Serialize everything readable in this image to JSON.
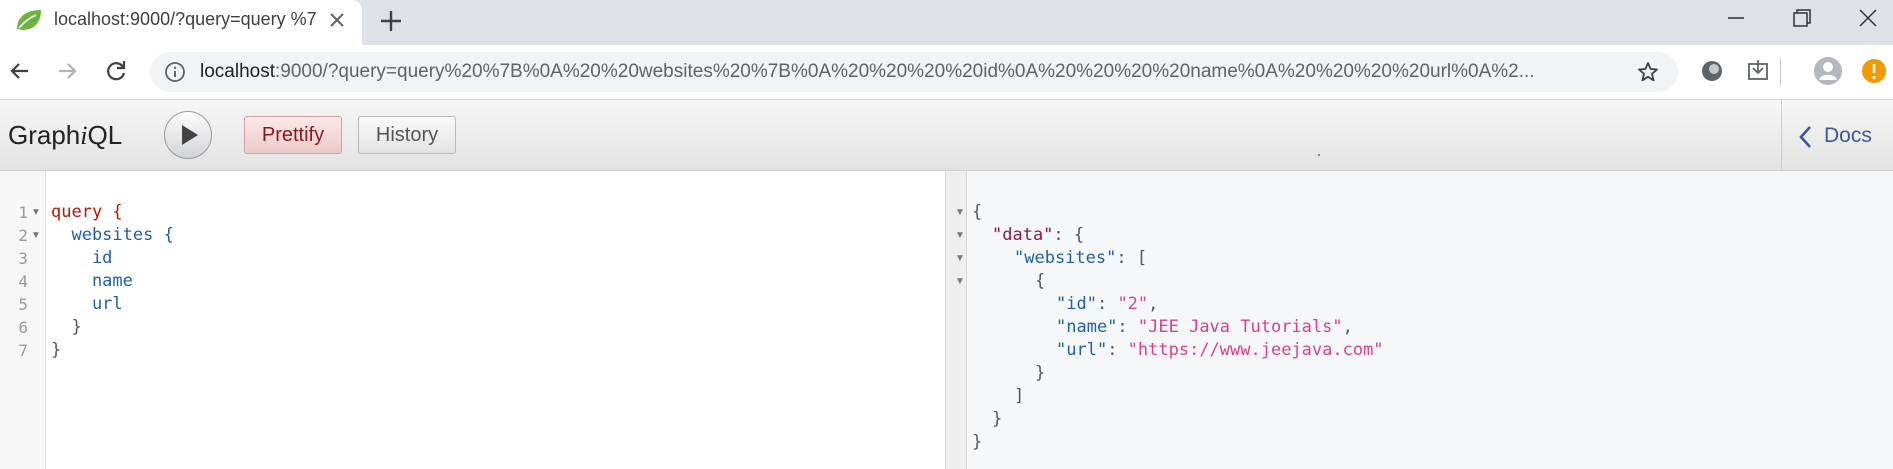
{
  "browser": {
    "tab_title": "localhost:9000/?query=query %7",
    "url_host": "localhost",
    "url_rest": ":9000/?query=query%20%7B%0A%20%20websites%20%7B%0A%20%20%20%20id%0A%20%20%20%20name%0A%20%20%20%20url%0A%2..."
  },
  "graphiql": {
    "title_pre": "Graph",
    "title_i": "i",
    "title_post": "QL",
    "prettify_label": "Prettify",
    "history_label": "History",
    "docs_label": "Docs"
  },
  "query_lines": [
    {
      "num": "1",
      "text": "query {"
    },
    {
      "num": "2",
      "text": "  websites {"
    },
    {
      "num": "3",
      "text": "    id"
    },
    {
      "num": "4",
      "text": "    name"
    },
    {
      "num": "5",
      "text": "    url"
    },
    {
      "num": "6",
      "text": "  }"
    },
    {
      "num": "7",
      "text": "}"
    }
  ],
  "result": {
    "data_key": "\"data\"",
    "websites_key": "\"websites\"",
    "id_key": "\"id\"",
    "id_val": "\"2\"",
    "name_key": "\"name\"",
    "name_val": "\"JEE Java Tutorials\"",
    "url_key": "\"url\"",
    "url_val": "\"https://www.jeejava.com\""
  },
  "colors": {
    "accent": "#8a1a1a",
    "docs_link": "#3b5998",
    "keyword": "#b11a04",
    "string": "#d64292"
  },
  "icons": [
    "leaf-favicon-icon",
    "close-icon",
    "plus-icon",
    "minimize-icon",
    "restore-icon",
    "close-window-icon",
    "back-icon",
    "forward-icon",
    "reload-icon",
    "info-icon",
    "star-icon",
    "extension-icon",
    "download-icon",
    "avatar-icon",
    "update-icon",
    "play-icon",
    "chevron-left-icon"
  ]
}
